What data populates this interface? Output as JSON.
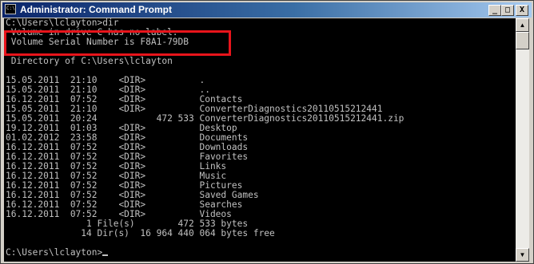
{
  "window": {
    "title": "Administrator: Command Prompt",
    "icon": "command-prompt-icon",
    "icon_glyph": "C:\\",
    "controls": {
      "minimize": "_",
      "maximize": "□",
      "close": "X"
    }
  },
  "console": {
    "lines": [
      "C:\\Users\\lclayton>dir",
      " Volume in drive C has no label.",
      " Volume Serial Number is F8A1-79DB",
      "",
      " Directory of C:\\Users\\lclayton",
      "",
      "15.05.2011  21:10    <DIR>          .",
      "15.05.2011  21:10    <DIR>          ..",
      "16.12.2011  07:52    <DIR>          Contacts",
      "15.05.2011  21:10    <DIR>          ConverterDiagnostics20110515212441",
      "15.05.2011  20:24           472 533 ConverterDiagnostics20110515212441.zip",
      "19.12.2011  01:03    <DIR>          Desktop",
      "01.02.2012  23:58    <DIR>          Documents",
      "16.12.2011  07:52    <DIR>          Downloads",
      "16.12.2011  07:52    <DIR>          Favorites",
      "16.12.2011  07:52    <DIR>          Links",
      "16.12.2011  07:52    <DIR>          Music",
      "16.12.2011  07:52    <DIR>          Pictures",
      "16.12.2011  07:52    <DIR>          Saved Games",
      "16.12.2011  07:52    <DIR>          Searches",
      "16.12.2011  07:52    <DIR>          Videos",
      "               1 File(s)        472 533 bytes",
      "              14 Dir(s)  16 964 440 064 bytes free",
      "",
      "C:\\Users\\lclayton>"
    ]
  },
  "colors": {
    "console_background": "#000000",
    "console_text": "#c0c0c0",
    "highlight_border": "#e8141b",
    "titlebar_start": "#0a246a",
    "titlebar_end": "#a6caf0"
  },
  "scrollbar": {
    "up_icon": "scroll-up-arrow-icon",
    "down_icon": "scroll-down-arrow-icon",
    "up_glyph": "▲",
    "down_glyph": "▼"
  }
}
